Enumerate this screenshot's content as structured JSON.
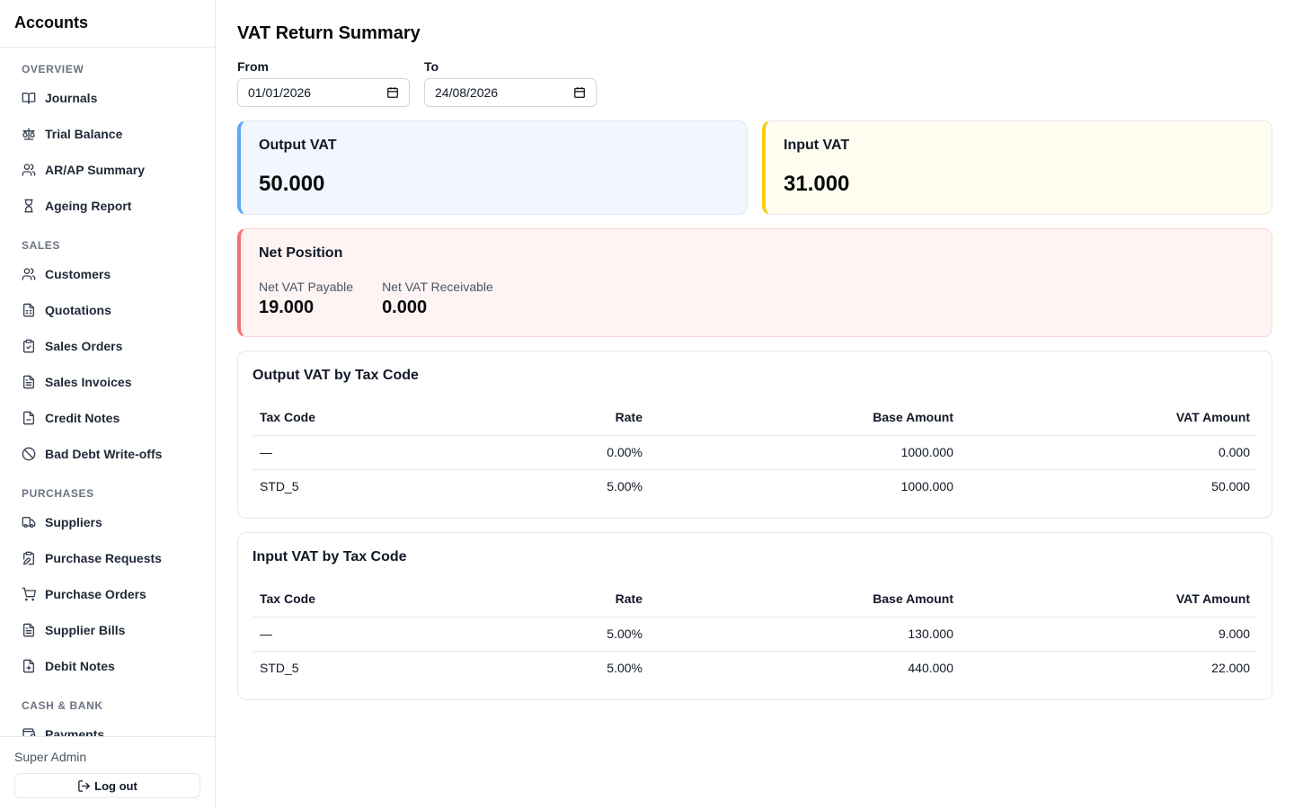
{
  "app_title": "Accounts",
  "sidebar": {
    "sections": [
      {
        "label": "OVERVIEW",
        "items": [
          {
            "label": "Journals",
            "icon": "book-open-icon"
          },
          {
            "label": "Trial Balance",
            "icon": "scale-icon"
          },
          {
            "label": "AR/AP Summary",
            "icon": "users-icon"
          },
          {
            "label": "Ageing Report",
            "icon": "hourglass-icon"
          }
        ]
      },
      {
        "label": "SALES",
        "items": [
          {
            "label": "Customers",
            "icon": "users-icon"
          },
          {
            "label": "Quotations",
            "icon": "file-spreadsheet-icon"
          },
          {
            "label": "Sales Orders",
            "icon": "clipboard-check-icon"
          },
          {
            "label": "Sales Invoices",
            "icon": "file-text-icon"
          },
          {
            "label": "Credit Notes",
            "icon": "file-icon"
          },
          {
            "label": "Bad Debt Write-offs",
            "icon": "ban-icon"
          }
        ]
      },
      {
        "label": "PURCHASES",
        "items": [
          {
            "label": "Suppliers",
            "icon": "truck-icon"
          },
          {
            "label": "Purchase Requests",
            "icon": "clipboard-edit-icon"
          },
          {
            "label": "Purchase Orders",
            "icon": "shopping-cart-icon"
          },
          {
            "label": "Supplier Bills",
            "icon": "file-text-icon"
          },
          {
            "label": "Debit Notes",
            "icon": "file-plus-icon"
          }
        ]
      },
      {
        "label": "CASH & BANK",
        "items": [
          {
            "label": "Payments",
            "icon": "wallet-icon"
          }
        ]
      }
    ],
    "footer": {
      "user": "Super Admin",
      "logout_label": "Log out"
    }
  },
  "main": {
    "title": "VAT Return Summary",
    "from_label": "From",
    "from_value": "01/01/2026",
    "to_label": "To",
    "to_value": "24/08/2026",
    "output_vat": {
      "label": "Output VAT",
      "value": "50.000"
    },
    "input_vat": {
      "label": "Input VAT",
      "value": "31.000"
    },
    "net_position": {
      "label": "Net Position",
      "payable_label": "Net VAT Payable",
      "payable_value": "19.000",
      "receivable_label": "Net VAT Receivable",
      "receivable_value": "0.000"
    },
    "output_table": {
      "title": "Output VAT by Tax Code",
      "headers": [
        "Tax Code",
        "Rate",
        "Base Amount",
        "VAT Amount"
      ],
      "rows": [
        [
          "—",
          "0.00%",
          "1000.000",
          "0.000"
        ],
        [
          "STD_5",
          "5.00%",
          "1000.000",
          "50.000"
        ]
      ]
    },
    "input_table": {
      "title": "Input VAT by Tax Code",
      "headers": [
        "Tax Code",
        "Rate",
        "Base Amount",
        "VAT Amount"
      ],
      "rows": [
        [
          "—",
          "5.00%",
          "130.000",
          "9.000"
        ],
        [
          "STD_5",
          "5.00%",
          "440.000",
          "22.000"
        ]
      ]
    }
  },
  "colors": {
    "output_accent": "#60a5fa",
    "input_accent": "#facc15",
    "net_accent": "#f87171"
  }
}
